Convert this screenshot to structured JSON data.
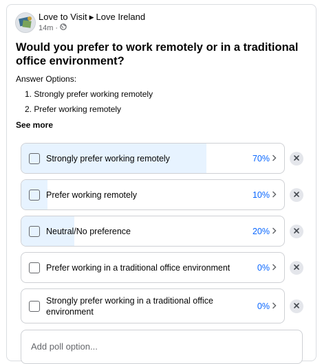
{
  "post": {
    "author": "Love to Visit",
    "group": "Love Ireland",
    "time": "14m",
    "question": "Would you prefer to work remotely or in a traditional office environment?",
    "answer_heading": "Answer Options:",
    "answer_lines": [
      "1. Strongly prefer working remotely",
      "2. Prefer working remotely"
    ],
    "see_more": "See more"
  },
  "poll": {
    "options": [
      {
        "label": "Strongly prefer working remotely",
        "percent_text": "70%",
        "percent": 70
      },
      {
        "label": "Prefer working remotely",
        "percent_text": "10%",
        "percent": 10
      },
      {
        "label": "Neutral/No preference",
        "percent_text": "20%",
        "percent": 20
      },
      {
        "label": "Prefer working in a traditional office environment",
        "percent_text": "0%",
        "percent": 0
      },
      {
        "label": "Strongly prefer working in a traditional office environment",
        "percent_text": "0%",
        "percent": 0
      }
    ],
    "add_placeholder": "Add poll option..."
  },
  "icons": {
    "separator": "caret-right-icon",
    "privacy": "globe-icon",
    "chevron": "chevron-right-icon",
    "remove": "close-icon"
  },
  "colors": {
    "fill": "#e7f3ff",
    "percent": "#0866ff",
    "muted": "#65676b"
  }
}
